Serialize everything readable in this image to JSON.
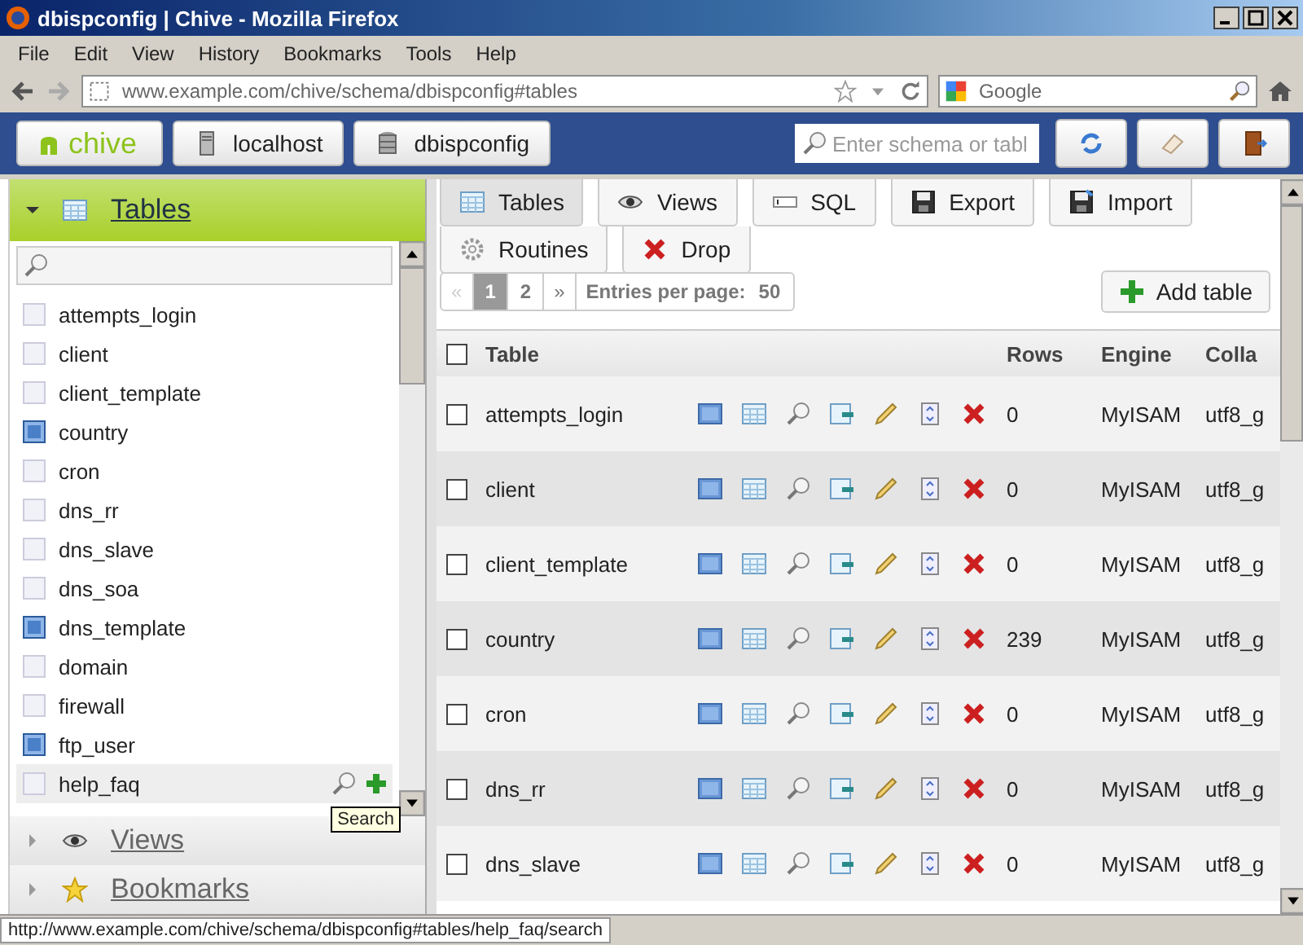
{
  "window": {
    "title": "dbispconfig | Chive - Mozilla Firefox"
  },
  "menu": [
    "File",
    "Edit",
    "View",
    "History",
    "Bookmarks",
    "Tools",
    "Help"
  ],
  "address_bar": {
    "value": "www.example.com/chive/schema/dbispconfig#tables"
  },
  "web_search": {
    "placeholder": "Google"
  },
  "app_bar": {
    "logo": "chive",
    "breadcrumbs": [
      "localhost",
      "dbispconfig"
    ],
    "search": {
      "placeholder": "Enter schema or tabl"
    }
  },
  "sidebar": {
    "sections": [
      {
        "label": "Tables",
        "expanded": true
      },
      {
        "label": "Views",
        "expanded": false
      },
      {
        "label": "Bookmarks",
        "expanded": false
      }
    ],
    "items": [
      {
        "name": "attempts_login",
        "has_rows": false,
        "hovered": false
      },
      {
        "name": "client",
        "has_rows": false,
        "hovered": false
      },
      {
        "name": "client_template",
        "has_rows": false,
        "hovered": false
      },
      {
        "name": "country",
        "has_rows": true,
        "hovered": false
      },
      {
        "name": "cron",
        "has_rows": false,
        "hovered": false
      },
      {
        "name": "dns_rr",
        "has_rows": false,
        "hovered": false
      },
      {
        "name": "dns_slave",
        "has_rows": false,
        "hovered": false
      },
      {
        "name": "dns_soa",
        "has_rows": false,
        "hovered": false
      },
      {
        "name": "dns_template",
        "has_rows": true,
        "hovered": false
      },
      {
        "name": "domain",
        "has_rows": false,
        "hovered": false
      },
      {
        "name": "firewall",
        "has_rows": false,
        "hovered": false
      },
      {
        "name": "ftp_user",
        "has_rows": true,
        "hovered": false
      },
      {
        "name": "help_faq",
        "has_rows": false,
        "hovered": true
      }
    ],
    "tooltip": "Search"
  },
  "toolbar": [
    {
      "label": "Tables",
      "kind": "tables",
      "selected": true
    },
    {
      "label": "Views",
      "kind": "views",
      "selected": false
    },
    {
      "label": "SQL",
      "kind": "sql",
      "selected": false
    },
    {
      "label": "Export",
      "kind": "export",
      "selected": false
    },
    {
      "label": "Import",
      "kind": "import",
      "selected": false
    },
    {
      "label": "Routines",
      "kind": "routines",
      "selected": false
    },
    {
      "label": "Drop",
      "kind": "drop",
      "selected": false
    }
  ],
  "pagination": {
    "pages": [
      {
        "label": "«",
        "kind": "prev",
        "selected": false,
        "disabled": true
      },
      {
        "label": "1",
        "kind": "page",
        "selected": true,
        "disabled": false
      },
      {
        "label": "2",
        "kind": "page",
        "selected": false,
        "disabled": false
      },
      {
        "label": "»",
        "kind": "next",
        "selected": false,
        "disabled": false
      }
    ],
    "entries_label": "Entries per page:",
    "entries_value": "50"
  },
  "add_table": "Add table",
  "table": {
    "columns": [
      "Table",
      "Rows",
      "Engine",
      "Colla"
    ],
    "all_checked": false,
    "rows": [
      {
        "checked": false,
        "name": "attempts_login",
        "rows": "0",
        "engine": "MyISAM",
        "collation": "utf8_g"
      },
      {
        "checked": false,
        "name": "client",
        "rows": "0",
        "engine": "MyISAM",
        "collation": "utf8_g"
      },
      {
        "checked": false,
        "name": "client_template",
        "rows": "0",
        "engine": "MyISAM",
        "collation": "utf8_g"
      },
      {
        "checked": false,
        "name": "country",
        "rows": "239",
        "engine": "MyISAM",
        "collation": "utf8_g"
      },
      {
        "checked": false,
        "name": "cron",
        "rows": "0",
        "engine": "MyISAM",
        "collation": "utf8_g"
      },
      {
        "checked": false,
        "name": "dns_rr",
        "rows": "0",
        "engine": "MyISAM",
        "collation": "utf8_g"
      },
      {
        "checked": false,
        "name": "dns_slave",
        "rows": "0",
        "engine": "MyISAM",
        "collation": "utf8_g"
      }
    ]
  },
  "status_bar": "http://www.example.com/chive/schema/dbispconfig#tables/help_faq/search"
}
